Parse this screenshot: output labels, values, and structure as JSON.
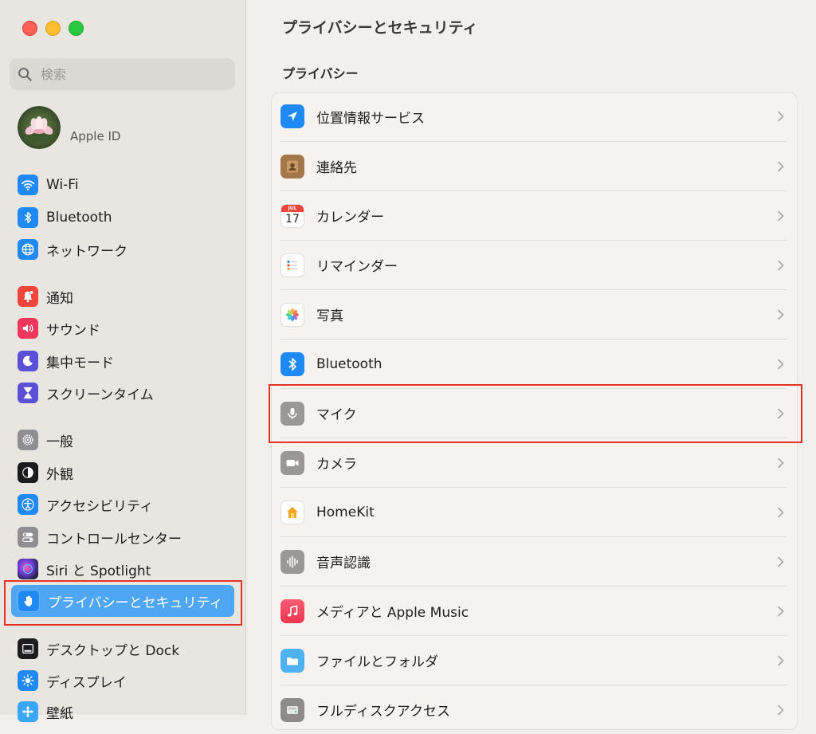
{
  "window": {
    "title": "プライバシーとセキュリティ"
  },
  "search": {
    "placeholder": "検索"
  },
  "account": {
    "label": "Apple ID"
  },
  "sidebar": {
    "items": [
      {
        "label": "Wi-Fi",
        "icon": "wifi-icon",
        "color": "#1f8af5"
      },
      {
        "label": "Bluetooth",
        "icon": "bluetooth-icon",
        "color": "#1f8af5"
      },
      {
        "label": "ネットワーク",
        "icon": "globe-icon",
        "color": "#1f8af5"
      },
      {
        "label": "通知",
        "icon": "bell-icon",
        "color": "#f0443a"
      },
      {
        "label": "サウンド",
        "icon": "speaker-icon",
        "color": "#f0365c"
      },
      {
        "label": "集中モード",
        "icon": "moon-icon",
        "color": "#5a4fd6"
      },
      {
        "label": "スクリーンタイム",
        "icon": "hourglass-icon",
        "color": "#5a4fd6"
      },
      {
        "label": "一般",
        "icon": "gear-icon",
        "color": "#8e8e93"
      },
      {
        "label": "外観",
        "icon": "appearance-icon",
        "color": "#1c1c1e"
      },
      {
        "label": "アクセシビリティ",
        "icon": "accessibility-icon",
        "color": "#1f8af5"
      },
      {
        "label": "コントロールセンター",
        "icon": "toggles-icon",
        "color": "#8e8e93"
      },
      {
        "label": "Siri と Spotlight",
        "icon": "siri-icon",
        "color": "#2b2b5a"
      },
      {
        "label": "プライバシーとセキュリティ",
        "icon": "hand-icon",
        "color": "#1f8af5"
      },
      {
        "label": "デスクトップと Dock",
        "icon": "dock-icon",
        "color": "#1c1c1e"
      },
      {
        "label": "ディスプレイ",
        "icon": "sun-icon",
        "color": "#1f8af5"
      },
      {
        "label": "壁紙",
        "icon": "wallpaper-icon",
        "color": "#3aa7f5"
      }
    ]
  },
  "main": {
    "section": "プライバシー",
    "rows": [
      {
        "label": "位置情報サービス",
        "icon": "location-arrow-icon"
      },
      {
        "label": "連絡先",
        "icon": "contacts-icon"
      },
      {
        "label": "カレンダー",
        "icon": "calendar-icon",
        "cal_month": "JUL",
        "cal_day": "17"
      },
      {
        "label": "リマインダー",
        "icon": "reminders-icon"
      },
      {
        "label": "写真",
        "icon": "photos-icon"
      },
      {
        "label": "Bluetooth",
        "icon": "bluetooth-icon"
      },
      {
        "label": "マイク",
        "icon": "microphone-icon"
      },
      {
        "label": "カメラ",
        "icon": "camera-icon"
      },
      {
        "label": "HomeKit",
        "icon": "home-icon"
      },
      {
        "label": "音声認識",
        "icon": "waveform-icon"
      },
      {
        "label": "メディアと Apple Music",
        "icon": "music-note-icon"
      },
      {
        "label": "ファイルとフォルダ",
        "icon": "folder-icon"
      },
      {
        "label": "フルディスクアクセス",
        "icon": "disk-icon"
      }
    ]
  },
  "colors": {
    "selection": "#4fa6f4",
    "highlight": "#e53323"
  }
}
